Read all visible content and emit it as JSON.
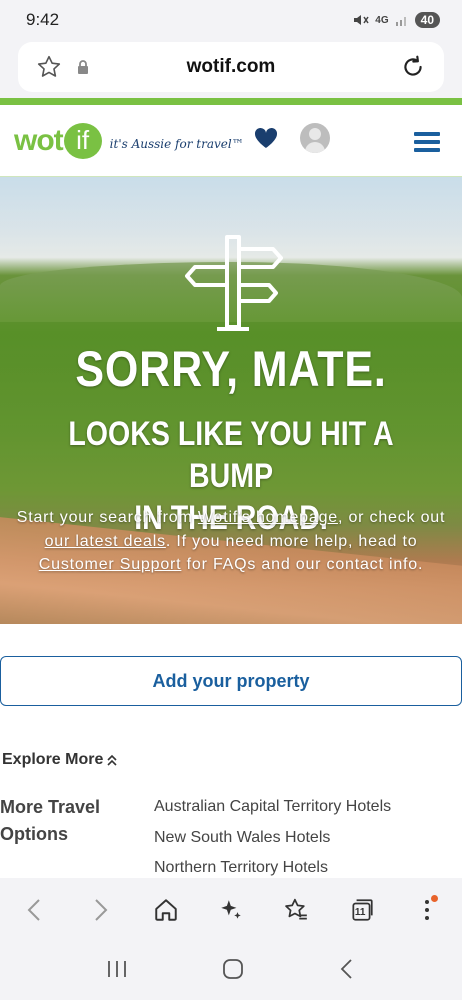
{
  "status_bar": {
    "time": "9:42",
    "network": "4G",
    "battery": "40"
  },
  "browser": {
    "url": "wotif.com"
  },
  "header": {
    "logo_text": "wot",
    "logo_if": "if",
    "tagline": "it's Aussie for travel™"
  },
  "hero": {
    "title": "SORRY, MATE.",
    "subtitle_line1": "LOOKS LIKE YOU HIT A BUMP",
    "subtitle_line2": "IN THE ROAD.",
    "body_1": "Start your search from ",
    "link_homepage": "Wotif's homepage",
    "body_2": ", or check out ",
    "link_deals": "our latest deals",
    "body_3": ". If you need more help, head to ",
    "link_support": "Customer Support",
    "body_4": " for FAQs and our contact info."
  },
  "main": {
    "add_property_label": "Add your property",
    "explore_label": "Explore More",
    "more_travel_label": "More Travel Options",
    "hotels": [
      "Australian Capital Territory Hotels",
      "New South Wales Hotels",
      "Northern Territory Hotels"
    ]
  },
  "toolbar": {
    "tabs_count": "11"
  },
  "colors": {
    "brand_green": "#7ac143",
    "brand_blue": "#1a5f9e",
    "heart": "#1a3e6e",
    "notification": "#e8632b"
  }
}
